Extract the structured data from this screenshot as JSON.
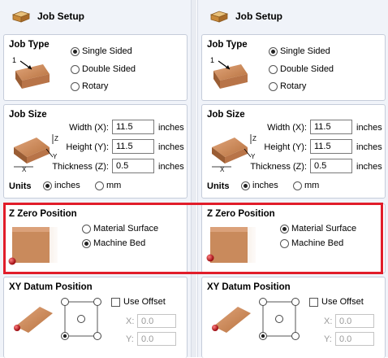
{
  "panels": [
    {
      "header": {
        "title": "Job Setup"
      },
      "job_type": {
        "title": "Job Type",
        "diagram_number": "1",
        "options": [
          "Single Sided",
          "Double Sided",
          "Rotary"
        ],
        "selected": "Single Sided"
      },
      "job_size": {
        "title": "Job Size",
        "width_label": "Width (X):",
        "width_value": "11.5",
        "width_unit": "inches",
        "height_label": "Height (Y):",
        "height_value": "11.5",
        "height_unit": "inches",
        "thickness_label": "Thickness (Z):",
        "thickness_value": "0.5",
        "thickness_unit": "inches",
        "units_label": "Units",
        "unit_options": [
          "inches",
          "mm"
        ],
        "unit_selected": "inches",
        "axis_z": "Z",
        "axis_y": "Y",
        "axis_x": "X"
      },
      "z_zero": {
        "title": "Z Zero Position",
        "options": [
          "Material Surface",
          "Machine Bed"
        ],
        "selected": "Machine Bed"
      },
      "xy_datum": {
        "title": "XY Datum Position",
        "use_offset_label": "Use Offset",
        "use_offset_checked": false,
        "x_label": "X:",
        "x_value": "0.0",
        "y_label": "Y:",
        "y_value": "0.0"
      }
    },
    {
      "header": {
        "title": "Job Setup"
      },
      "job_type": {
        "title": "Job Type",
        "diagram_number": "1",
        "options": [
          "Single Sided",
          "Double Sided",
          "Rotary"
        ],
        "selected": "Single Sided"
      },
      "job_size": {
        "title": "Job Size",
        "width_label": "Width (X):",
        "width_value": "11.5",
        "width_unit": "inches",
        "height_label": "Height (Y):",
        "height_value": "11.5",
        "height_unit": "inches",
        "thickness_label": "Thickness (Z):",
        "thickness_value": "0.5",
        "thickness_unit": "inches",
        "units_label": "Units",
        "unit_options": [
          "inches",
          "mm"
        ],
        "unit_selected": "inches",
        "axis_z": "Z",
        "axis_y": "Y",
        "axis_x": "X"
      },
      "z_zero": {
        "title": "Z Zero Position",
        "options": [
          "Material Surface",
          "Machine Bed"
        ],
        "selected": "Material Surface"
      },
      "xy_datum": {
        "title": "XY Datum Position",
        "use_offset_label": "Use Offset",
        "use_offset_checked": false,
        "x_label": "X:",
        "x_value": "0.0",
        "y_label": "Y:",
        "y_value": "0.0"
      }
    }
  ],
  "colors": {
    "highlight": "#e11d2a",
    "wood": "#c8845a",
    "wood_dark": "#a0633c",
    "datum_dot": "#c0101a"
  }
}
